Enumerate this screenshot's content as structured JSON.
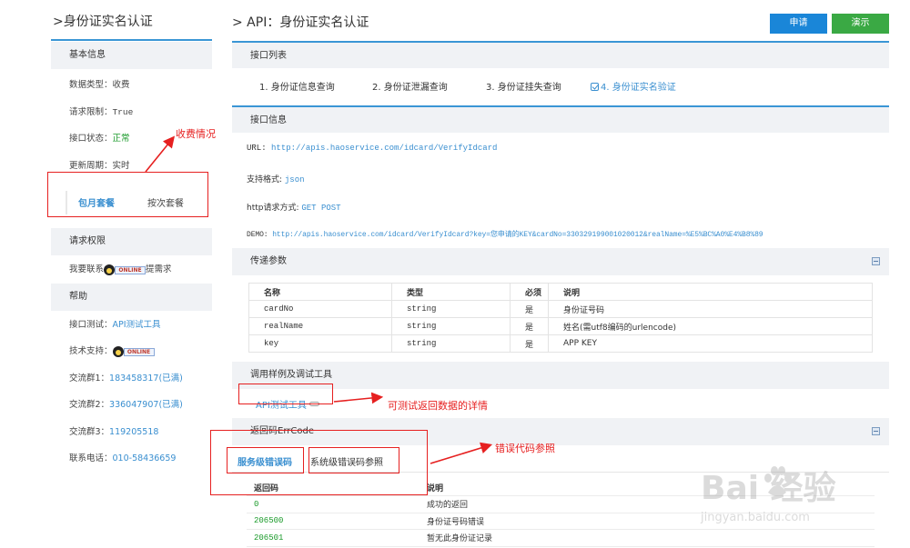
{
  "sidebar": {
    "title": ">身份证实名认证",
    "basic_header": "基本信息",
    "data_type": {
      "label": "数据类型：",
      "value": "收费"
    },
    "request_limit": {
      "label": "请求限制：",
      "value": "True"
    },
    "api_status": {
      "label": "接口状态：",
      "value": "正常"
    },
    "update_cycle": {
      "label": "更新周期：",
      "value": "实时"
    },
    "plan_monthly": "包月套餐",
    "plan_per_call": "按次套餐",
    "permission_header": "请求权限",
    "contact": {
      "prefix": "我要联系",
      "suffix": "提需求"
    },
    "help_header": "帮助",
    "api_test": {
      "label": "接口测试：",
      "value": "API测试工具"
    },
    "tech_support": {
      "label": "技术支持："
    },
    "online_badge": "ONLINE",
    "group1": {
      "label": "交流群1：",
      "value": "183458317(已满)"
    },
    "group2": {
      "label": "交流群2：",
      "value": "336047907(已满)"
    },
    "group3": {
      "label": "交流群3：",
      "value": "119205518"
    },
    "phone": {
      "label": "联系电话：",
      "value": "010-58436659"
    }
  },
  "main": {
    "title": "> API：身份证实名认证",
    "apply_button": "申请",
    "demo_button": "演示",
    "api_list_header": "接口列表",
    "tabs": [
      "1. 身份证信息查询",
      "2. 身份证泄漏查询",
      "3. 身份证挂失查询",
      "4. 身份证实名验证"
    ],
    "api_info_header": "接口信息",
    "url": {
      "label": "URL: ",
      "value": "http://apis.haoservice.com/idcard/VerifyIdcard"
    },
    "format": {
      "label": "支持格式: ",
      "value": "json"
    },
    "method": {
      "label": "http请求方式: ",
      "value": "GET POST"
    },
    "demo": {
      "label": "DEMO: ",
      "value": "http://apis.haoservice.com/idcard/VerifyIdcard?key=您申请的KEY&cardNo=330329199001020012&realName=%E5%BC%A0%E4%B8%89"
    },
    "params_header": "传递参数",
    "params_columns": [
      "名称",
      "类型",
      "必须",
      "说明"
    ],
    "params": [
      [
        "cardNo",
        "string",
        "是",
        "身份证号码"
      ],
      [
        "realName",
        "string",
        "是",
        "姓名(需utf8编码的urlencode)"
      ],
      [
        "key",
        "string",
        "是",
        "APP KEY"
      ]
    ],
    "samples_header": "调用样例及调试工具",
    "api_tool_link": "API测试工具",
    "errcode_header": "返回码ErrCode",
    "err_tab_service": "服务级错误码",
    "err_tab_system": "系统级错误码参照",
    "err_columns": [
      "返回码",
      "说明"
    ],
    "errors": [
      [
        "0",
        "成功的返回"
      ],
      [
        "206500",
        "身份证号码错误"
      ],
      [
        "206501",
        "暂无此身份证记录"
      ]
    ]
  },
  "annotations": {
    "fee_note": "收费情况",
    "test_note": "可测试返回数据的详情",
    "err_note": "错误代码参照"
  },
  "watermark": {
    "brand": "Bai 经验",
    "url": "jingyan.baidu.com"
  },
  "colors": {
    "accent": "#3a96d5",
    "apply": "#1a86d8",
    "demo": "#3aa944",
    "annotation": "#e62020"
  }
}
